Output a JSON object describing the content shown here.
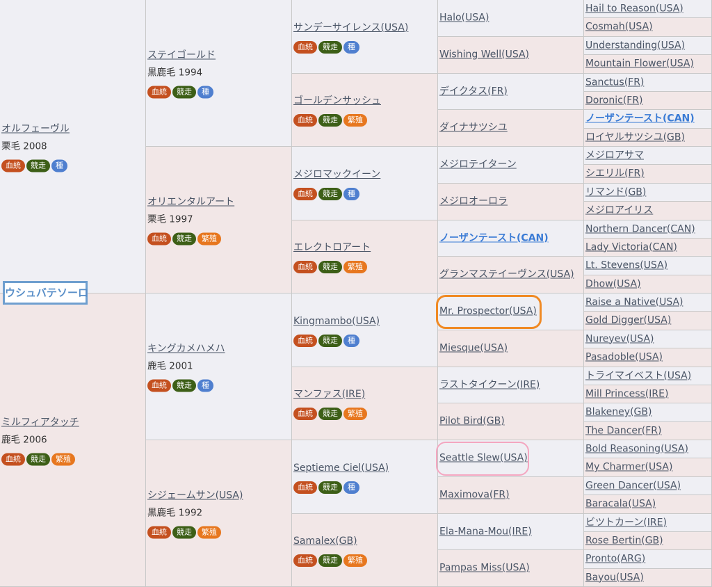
{
  "horse": "ウシュバテソーロ",
  "badge_labels": {
    "blood": "血統",
    "race": "競走",
    "seed": "種",
    "breed": "繁殖"
  },
  "colors": {
    "sire_bg": "#efeff4",
    "dam_bg": "#f2e7e7",
    "link": "#4a5566",
    "highlight_link": "#3a7bd5",
    "blood_badge": "#c4501f",
    "race_badge": "#3d5f17",
    "seed_badge": "#4f7fcf",
    "breed_badge": "#e7771f",
    "mark_orange": "#f08a24",
    "mark_pink": "#f4a6c0",
    "horse_label_border": "#6f9fcf"
  },
  "gen1": [
    {
      "name": "オルフェーヴル",
      "info": "栗毛 2008",
      "badges": [
        "blood",
        "race",
        "seed"
      ]
    },
    {
      "name": "ミルフィアタッチ",
      "info": "鹿毛 2006",
      "badges": [
        "blood",
        "race",
        "breed"
      ]
    }
  ],
  "gen2": [
    {
      "name": "ステイゴールド",
      "info": "黒鹿毛 1994",
      "badges": [
        "blood",
        "race",
        "seed"
      ]
    },
    {
      "name": "オリエンタルアート",
      "info": "栗毛 1997",
      "badges": [
        "blood",
        "race",
        "breed"
      ]
    },
    {
      "name": "キングカメハメハ",
      "info": "鹿毛 2001",
      "badges": [
        "blood",
        "race",
        "seed"
      ]
    },
    {
      "name": "シジェームサン(USA)",
      "info": "黒鹿毛 1992",
      "badges": [
        "blood",
        "race",
        "breed"
      ]
    }
  ],
  "gen3": [
    {
      "name": "サンデーサイレンス(USA)",
      "badges": [
        "blood",
        "race",
        "seed"
      ]
    },
    {
      "name": "ゴールデンサッシュ",
      "badges": [
        "blood",
        "race",
        "breed"
      ]
    },
    {
      "name": "メジロマックイーン",
      "badges": [
        "blood",
        "race",
        "seed"
      ]
    },
    {
      "name": "エレクトロアート",
      "badges": [
        "blood",
        "race",
        "breed"
      ]
    },
    {
      "name": "Kingmambo(USA)",
      "badges": [
        "blood",
        "race",
        "seed"
      ]
    },
    {
      "name": "マンファス(IRE)",
      "badges": [
        "blood",
        "race",
        "breed"
      ]
    },
    {
      "name": "Septieme Ciel(USA)",
      "badges": [
        "blood",
        "race",
        "seed"
      ]
    },
    {
      "name": "Samalex(GB)",
      "badges": [
        "blood",
        "race",
        "breed"
      ]
    }
  ],
  "gen4": [
    {
      "name": "Halo(USA)"
    },
    {
      "name": "Wishing Well(USA)"
    },
    {
      "name": "デイクタス(FR)"
    },
    {
      "name": "ダイナサツシユ"
    },
    {
      "name": "メジロテイターン"
    },
    {
      "name": "メジロオーロラ"
    },
    {
      "name": "ノーザンテースト(CAN)",
      "highlight": true
    },
    {
      "name": "グランマステイーヴンス(USA)"
    },
    {
      "name": "Mr. Prospector(USA)",
      "mark": "orange"
    },
    {
      "name": "Miesque(USA)"
    },
    {
      "name": "ラストタイクーン(IRE)"
    },
    {
      "name": "Pilot Bird(GB)"
    },
    {
      "name": "Seattle Slew(USA)",
      "mark": "pink"
    },
    {
      "name": "Maximova(FR)"
    },
    {
      "name": "Ela-Mana-Mou(IRE)"
    },
    {
      "name": "Pampas Miss(USA)"
    }
  ],
  "gen5": [
    {
      "name": "Hail to Reason(USA)"
    },
    {
      "name": "Cosmah(USA)"
    },
    {
      "name": "Understanding(USA)"
    },
    {
      "name": "Mountain Flower(USA)"
    },
    {
      "name": "Sanctus(FR)"
    },
    {
      "name": "Doronic(FR)"
    },
    {
      "name": "ノーザンテースト(CAN)",
      "highlight": true
    },
    {
      "name": "ロイヤルサツシユ(GB)"
    },
    {
      "name": "メジロアサマ"
    },
    {
      "name": "シエリル(FR)"
    },
    {
      "name": "リマンド(GB)"
    },
    {
      "name": "メジロアイリス"
    },
    {
      "name": "Northern Dancer(CAN)"
    },
    {
      "name": "Lady Victoria(CAN)"
    },
    {
      "name": "Lt. Stevens(USA)"
    },
    {
      "name": "Dhow(USA)"
    },
    {
      "name": "Raise a Native(USA)"
    },
    {
      "name": "Gold Digger(USA)"
    },
    {
      "name": "Nureyev(USA)"
    },
    {
      "name": "Pasadoble(USA)"
    },
    {
      "name": "トライマイベスト(USA)"
    },
    {
      "name": "Mill Princess(IRE)"
    },
    {
      "name": "Blakeney(GB)"
    },
    {
      "name": "The Dancer(FR)"
    },
    {
      "name": "Bold Reasoning(USA)"
    },
    {
      "name": "My Charmer(USA)"
    },
    {
      "name": "Green Dancer(USA)"
    },
    {
      "name": "Baracala(USA)"
    },
    {
      "name": "ビツトカーン(IRE)"
    },
    {
      "name": "Rose Bertin(GB)"
    },
    {
      "name": "Pronto(ARG)"
    },
    {
      "name": "Bayou(USA)"
    }
  ]
}
